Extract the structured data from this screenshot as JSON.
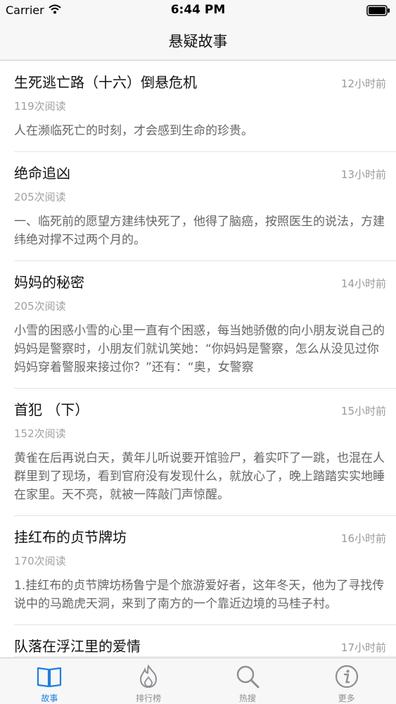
{
  "status_bar": {
    "carrier": "Carrier",
    "time": "6:44 PM"
  },
  "nav": {
    "title": "悬疑故事"
  },
  "stories": [
    {
      "title": "生死逃亡路（十六）倒悬危机",
      "time": "12小时前",
      "reads": "119次阅读",
      "summary": "人在濒临死亡的时刻，才会感到生命的珍贵。"
    },
    {
      "title": "绝命追凶",
      "time": "13小时前",
      "reads": "205次阅读",
      "summary": "一、临死前的愿望方建纬快死了，他得了脑癌，按照医生的说法，方建纬绝对撑不过两个月的。"
    },
    {
      "title": "妈妈的秘密",
      "time": "14小时前",
      "reads": "205次阅读",
      "summary": "小雪的困惑小雪的心里一直有个困惑，每当她骄傲的向小朋友说自己的妈妈是警察时，小朋友们就讥笑她：“你妈妈是警察，怎么从没见过你妈妈穿着警服来接过你？”还有：“奥，女警察"
    },
    {
      "title": "首犯 （下）",
      "time": "15小时前",
      "reads": "152次阅读",
      "summary": "黄雀在后再说白天，黄年儿听说要开馆验尸，着实吓了一跳，也混在人群里到了现场，看到官府没有发现什么，就放心了，晚上踏踏实实地睡在家里。天不亮，就被一阵敲门声惊醒。"
    },
    {
      "title": "挂红布的贞节牌坊",
      "time": "16小时前",
      "reads": "170次阅读",
      "summary": "1.挂红布的贞节牌坊杨鲁宁是个旅游爱好者，这年冬天，他为了寻找传说中的马跪虎天洞，来到了南方的一个靠近边境的马桂子村。"
    },
    {
      "title": "队落在浮江里的爱情",
      "time": "17小时前",
      "reads": "",
      "summary": ""
    }
  ],
  "tabs": [
    {
      "label": "故事",
      "icon": "book-icon",
      "active": true
    },
    {
      "label": "排行榜",
      "icon": "flame-icon",
      "active": false
    },
    {
      "label": "热搜",
      "icon": "search-icon",
      "active": false
    },
    {
      "label": "更多",
      "icon": "info-icon",
      "active": false
    }
  ],
  "colors": {
    "accent": "#1e7fe0",
    "inactive": "#8e8e93"
  }
}
